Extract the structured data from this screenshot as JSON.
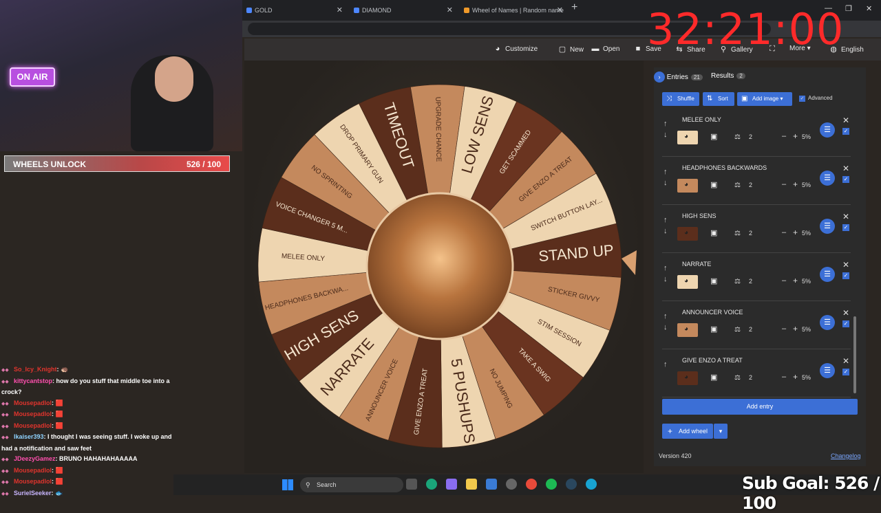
{
  "browser": {
    "tabs": [
      {
        "title": "GOLD"
      },
      {
        "title": "DIAMOND"
      },
      {
        "title": "Wheel of Names | Random name"
      }
    ]
  },
  "header": {
    "buttons": [
      {
        "label": "Customize",
        "icon": "palette-icon"
      },
      {
        "label": "New",
        "icon": "new-file-icon"
      },
      {
        "label": "Open",
        "icon": "folder-icon"
      },
      {
        "label": "Save",
        "icon": "save-icon"
      },
      {
        "label": "Share",
        "icon": "share-icon"
      },
      {
        "label": "Gallery",
        "icon": "search-icon"
      },
      {
        "label": "More",
        "icon": "chevron-down-icon"
      },
      {
        "label": "English",
        "icon": "globe-icon"
      }
    ]
  },
  "overlay": {
    "timer": "32:21:00",
    "wheels_unlock_label": "WHEELS UNLOCK",
    "wheels_unlock_value": "526 / 100",
    "on_air": "ON AIR",
    "sub_goal": "Sub Goal: 526 / 100"
  },
  "wheel": {
    "segments": [
      {
        "label": "STAND UP",
        "color": "#5b2e1c"
      },
      {
        "label": "STICKER GIVVY",
        "color": "#c4895d"
      },
      {
        "label": "STIM SESSION",
        "color": "#eed5b0"
      },
      {
        "label": "TAKE A SWIG",
        "color": "#6a3420"
      },
      {
        "label": "NO JUMPING",
        "color": "#c4895d"
      },
      {
        "label": "5 PUSHUPS",
        "color": "#eed5b0"
      },
      {
        "label": "GIVE ENZO A TREAT",
        "color": "#5b2e1c"
      },
      {
        "label": "ANNOUNCER VOICE",
        "color": "#c4895d"
      },
      {
        "label": "NARRATE",
        "color": "#eed5b0"
      },
      {
        "label": "HIGH SENS",
        "color": "#5b2e1c"
      },
      {
        "label": "HEADPHONES BACKWA...",
        "color": "#c4895d"
      },
      {
        "label": "MELEE ONLY",
        "color": "#eed5b0"
      },
      {
        "label": "VOICE CHANGER 5 M...",
        "color": "#5b2e1c"
      },
      {
        "label": "NO SPRINTING",
        "color": "#c4895d"
      },
      {
        "label": "DROP PRIMARY GUN",
        "color": "#eed5b0"
      },
      {
        "label": "TIMEOUT",
        "color": "#5b2e1c"
      },
      {
        "label": "UPGRADE CHANCE",
        "color": "#c4895d"
      },
      {
        "label": "LOW SENS",
        "color": "#eed5b0"
      },
      {
        "label": "GET SCAMMED",
        "color": "#6a3420"
      },
      {
        "label": "GIVE ENZO A TREAT",
        "color": "#c4895d"
      },
      {
        "label": "SWITCH BUTTON LAY...",
        "color": "#eed5b0"
      }
    ]
  },
  "panel": {
    "entries_tab": "Entries",
    "entries_count": "21",
    "results_tab": "Results",
    "results_count": "2",
    "toolbar": {
      "shuffle": "Shuffle",
      "sort": "Sort",
      "add_image": "Add image",
      "advanced": "Advanced"
    },
    "entries": [
      {
        "name": "MELEE ONLY",
        "weight": "2",
        "percent": "5%",
        "color": "#eed5b0"
      },
      {
        "name": "HEADPHONES BACKWARDS",
        "weight": "2",
        "percent": "5%",
        "color": "#c4895d"
      },
      {
        "name": "HIGH SENS",
        "weight": "2",
        "percent": "5%",
        "color": "#5b2e1c"
      },
      {
        "name": "NARRATE",
        "weight": "2",
        "percent": "5%",
        "color": "#eed5b0"
      },
      {
        "name": "ANNOUNCER VOICE",
        "weight": "2",
        "percent": "5%",
        "color": "#c4895d"
      },
      {
        "name": "GIVE ENZO A TREAT",
        "weight": "2",
        "percent": "5%",
        "color": "#5b2e1c"
      }
    ],
    "add_entry": "Add entry",
    "add_wheel": "Add wheel",
    "version": "Version 420",
    "changelog": "Changelog"
  },
  "chat": [
    {
      "user": "So_Icy_Knight",
      "msg": ": 🦔",
      "color": "#e0342d"
    },
    {
      "user": "kittycantstop",
      "msg": ": how do you stuff that middle toe into a",
      "color": "#ff4fae"
    },
    {
      "user": "",
      "msg": "crock?",
      "color": "#fff"
    },
    {
      "user": "Mousepadlol",
      "msg": ": 🟥",
      "color": "#e0342d"
    },
    {
      "user": "Mousepadlol",
      "msg": ": 🟥",
      "color": "#e0342d"
    },
    {
      "user": "Mousepadlol",
      "msg": ": 🟥",
      "color": "#e0342d"
    },
    {
      "user": "lkaiser393",
      "msg": ": I thought I was seeing stuff. I woke up and",
      "color": "#8fd3ff"
    },
    {
      "user": "",
      "msg": "had a notification and saw feet",
      "color": "#fff"
    },
    {
      "user": "JDeezyGamez",
      "msg": ": BRUNO HAHAHAHAAAAA",
      "color": "#ff4fae"
    },
    {
      "user": "Mousepadlol",
      "msg": ": 🟥",
      "color": "#e0342d"
    },
    {
      "user": "Mousepadlol",
      "msg": ": 🟥",
      "color": "#e0342d"
    },
    {
      "user": "SurielSeeker",
      "msg": ": 🐟",
      "color": "#c9b6ff"
    }
  ],
  "taskbar": {
    "search": "Search"
  }
}
